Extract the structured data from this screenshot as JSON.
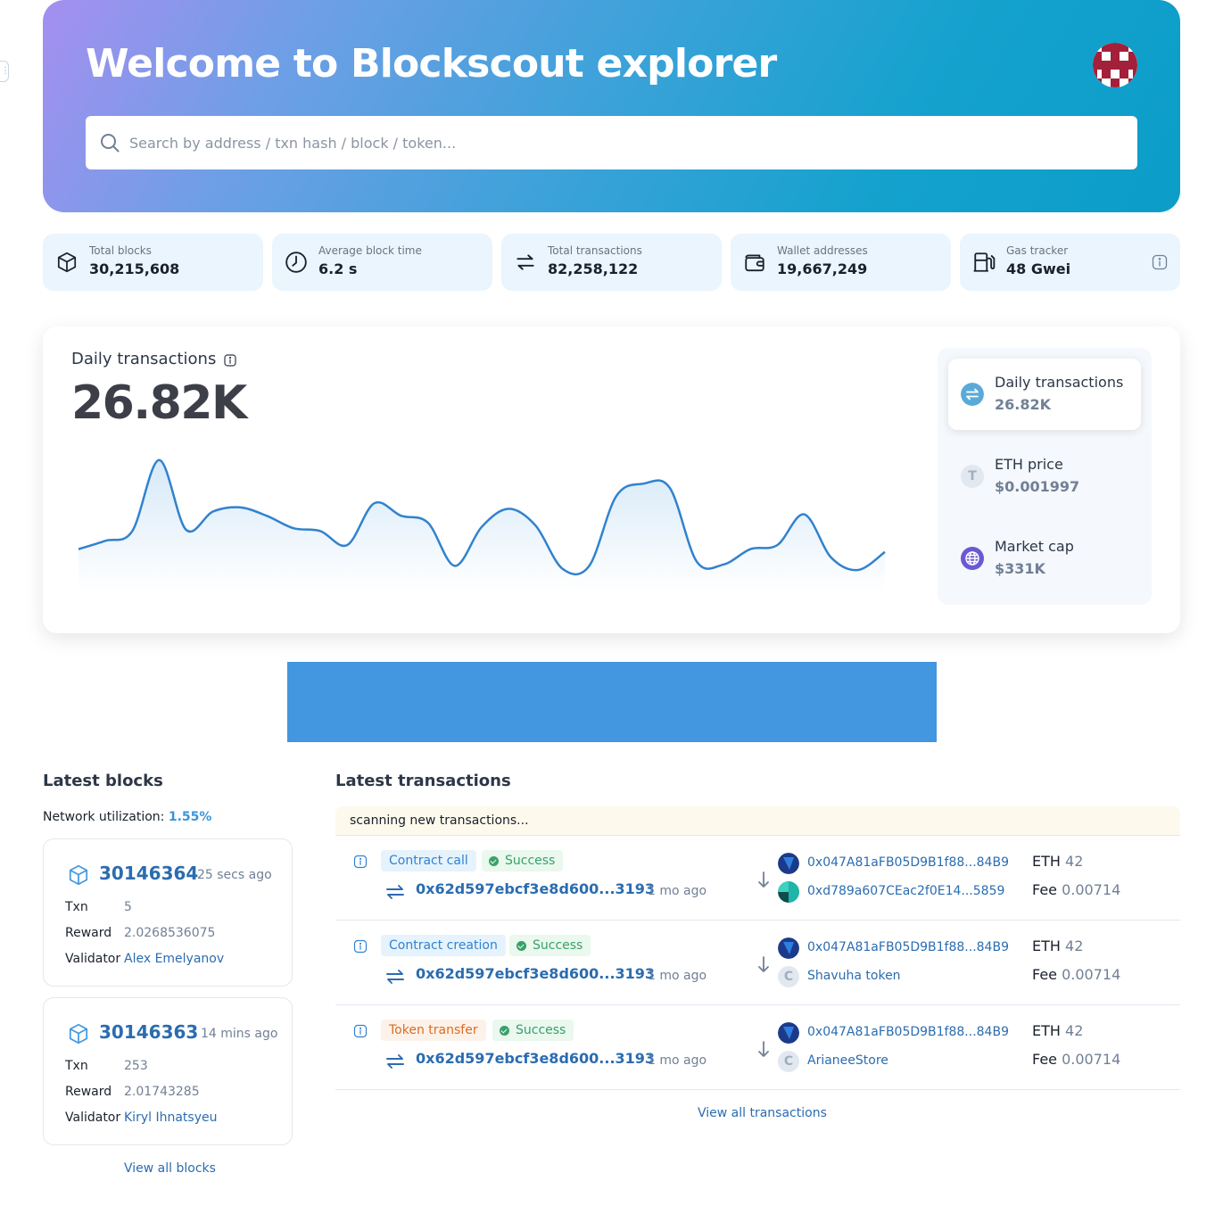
{
  "hero": {
    "title": "Welcome to Blockscout explorer",
    "search_placeholder": "Search by address / txn hash / block / token..."
  },
  "stats": [
    {
      "label": "Total blocks",
      "value": "30,215,608",
      "icon": "cube-icon"
    },
    {
      "label": "Average block time",
      "value": "6.2 s",
      "icon": "clock-icon"
    },
    {
      "label": "Total transactions",
      "value": "82,258,122",
      "icon": "transactions-icon"
    },
    {
      "label": "Wallet addresses",
      "value": "19,667,249",
      "icon": "wallet-icon"
    },
    {
      "label": "Gas tracker",
      "value": "48 Gwei",
      "icon": "gas-icon"
    }
  ],
  "chart": {
    "title": "Daily transactions",
    "big_value": "26.82K"
  },
  "chart_data": {
    "type": "area",
    "title": "Daily transactions",
    "x": [
      0,
      1,
      2,
      3,
      4,
      5,
      6,
      7,
      8,
      9,
      10,
      11,
      12,
      13,
      14,
      15,
      16,
      17,
      18,
      19,
      20,
      21,
      22,
      23,
      24,
      25,
      26,
      27,
      28,
      29,
      30
    ],
    "values": [
      0.31,
      0.37,
      0.44,
      0.95,
      0.45,
      0.58,
      0.61,
      0.55,
      0.46,
      0.44,
      0.34,
      0.64,
      0.55,
      0.5,
      0.19,
      0.47,
      0.6,
      0.48,
      0.17,
      0.19,
      0.69,
      0.78,
      0.75,
      0.22,
      0.2,
      0.31,
      0.34,
      0.56,
      0.25,
      0.16,
      0.29
    ],
    "grid": false,
    "legend": "none",
    "colors": {
      "line": "#3182ce",
      "fill_top": "#d6e9f8",
      "fill_bottom": "#ffffff"
    }
  },
  "indicators": [
    {
      "title": "Daily transactions",
      "value": "26.82K",
      "icon": "transactions-icon",
      "active": true
    },
    {
      "title": "ETH price",
      "value": "$0.001997",
      "icon": "token-letter-icon",
      "letter": "T",
      "active": false
    },
    {
      "title": "Market cap",
      "value": "$331K",
      "icon": "globe-icon",
      "active": false
    }
  ],
  "latest_blocks": {
    "title": "Latest blocks",
    "network_label": "Network utilization:",
    "network_value": "1.55%",
    "labels": {
      "txn": "Txn",
      "reward": "Reward",
      "validator": "Validator"
    },
    "blocks": [
      {
        "number": "30146364",
        "age": "25 secs ago",
        "txn": "5",
        "reward": "2.0268536075",
        "validator": "Alex Emelyanov"
      },
      {
        "number": "30146363",
        "age": "14 mins ago",
        "txn": "253",
        "reward": "2.01743285",
        "validator": "Kiryl Ihnatsyeu"
      }
    ],
    "view_all": "View all blocks"
  },
  "latest_transactions": {
    "title": "Latest transactions",
    "scanning": "scanning new transactions...",
    "labels": {
      "eth": "ETH",
      "fee": "Fee"
    },
    "rows": [
      {
        "type": "Contract call",
        "type_color": "blue",
        "status": "Success",
        "hash": "0x62d597ebcf3e8d600...3193",
        "age": "1 mo ago",
        "from": "0x047A81aFB05D9B1f88...84B9",
        "to": "0xd789a607CEac2f0E14...5859",
        "to_letter": "",
        "eth": "42",
        "fee": "0.00714"
      },
      {
        "type": "Contract creation",
        "type_color": "blue",
        "status": "Success",
        "hash": "0x62d597ebcf3e8d600...3193",
        "age": "1 mo ago",
        "from": "0x047A81aFB05D9B1f88...84B9",
        "to": "Shavuha token",
        "to_letter": "C",
        "eth": "42",
        "fee": "0.00714"
      },
      {
        "type": "Token transfer",
        "type_color": "orange",
        "status": "Success",
        "hash": "0x62d597ebcf3e8d600...3193",
        "age": "1 mo ago",
        "from": "0x047A81aFB05D9B1f88...84B9",
        "to": "ArianeeStore",
        "to_letter": "C",
        "eth": "42",
        "fee": "0.00714"
      }
    ],
    "view_all": "View all transactions"
  }
}
